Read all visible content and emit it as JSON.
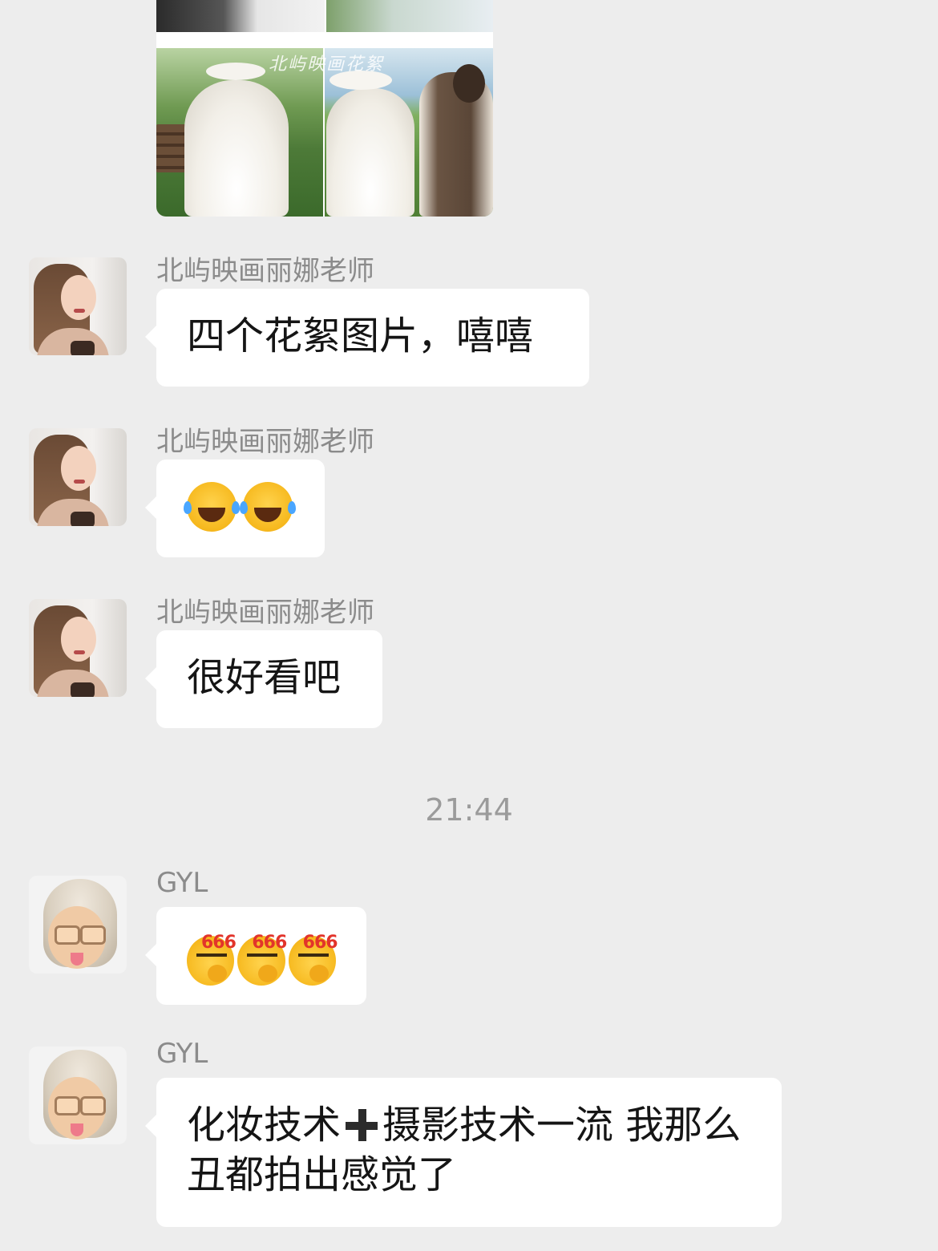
{
  "photo_collage": {
    "watermark": "北屿映画花絮"
  },
  "messages": [
    {
      "sender": "北屿映画丽娜老师",
      "text": "四个花絮图片，嘻嘻"
    },
    {
      "sender": "北屿映画丽娜老师",
      "emoji": [
        "face-with-tears-of-joy",
        "face-with-tears-of-joy"
      ]
    },
    {
      "sender": "北屿映画丽娜老师",
      "text": "很好看吧"
    },
    {
      "sender": "GYL",
      "emoji": [
        "666-thinking-face",
        "666-thinking-face",
        "666-thinking-face"
      ],
      "emoji_label": "666"
    },
    {
      "sender": "GYL",
      "text_part1": "化妆技术",
      "text_part2": "摄影技术一流 我那么丑都拍出感觉了"
    }
  ],
  "timestamp": "21:44",
  "colors": {
    "background": "#ededed",
    "bubble": "#ffffff",
    "sender": "#8b8b8b"
  }
}
